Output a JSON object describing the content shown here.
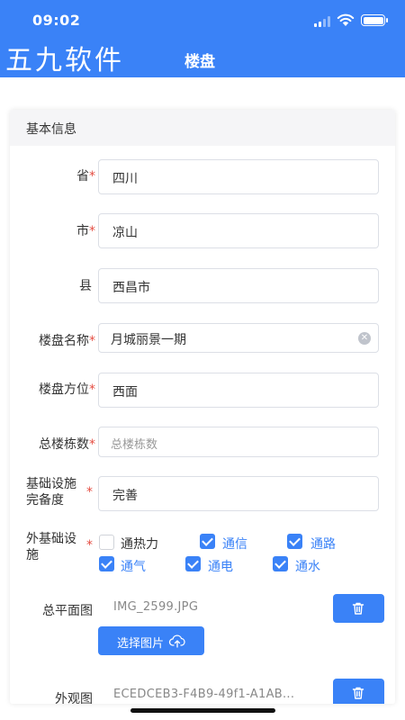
{
  "status_bar": {
    "time": "09:02"
  },
  "nav": {
    "brand": "五九软件",
    "title": "楼盘"
  },
  "section": {
    "title": "基本信息"
  },
  "form": {
    "province": {
      "label": "省",
      "value": "四川"
    },
    "city": {
      "label": "市",
      "value": "凉山"
    },
    "county": {
      "label": "县",
      "value": "西昌市"
    },
    "estate_name": {
      "label": "楼盘名称",
      "value": "月城丽景一期"
    },
    "estate_direction": {
      "label": "楼盘方位",
      "value": "西面"
    },
    "total_buildings": {
      "label": "总楼栋数",
      "value": "",
      "placeholder": "总楼栋数"
    },
    "infra_completeness": {
      "label_line1": "基础设施",
      "label_line2": "完备度",
      "value": "完善"
    },
    "external_infra": {
      "label_line1": "外基础设",
      "label_line2": "施",
      "options": [
        {
          "label": "通热力",
          "checked": false
        },
        {
          "label": "通信",
          "checked": true
        },
        {
          "label": "通路",
          "checked": true
        },
        {
          "label": "通气",
          "checked": true
        },
        {
          "label": "通电",
          "checked": true
        },
        {
          "label": "通水",
          "checked": true
        }
      ]
    },
    "site_plan": {
      "label": "总平面图",
      "filename": "IMG_2599.JPG",
      "pick_label": "选择图片"
    },
    "exterior": {
      "label": "外观图",
      "filename": "ECEDCEB3-F4B9-49f1-A1AB..."
    }
  },
  "icons": {
    "trash": "trash-icon",
    "upload_cloud": "cloud-upload-icon",
    "clear": "clear-icon"
  },
  "colors": {
    "primary": "#3a82f7",
    "required": "#e54d42"
  }
}
